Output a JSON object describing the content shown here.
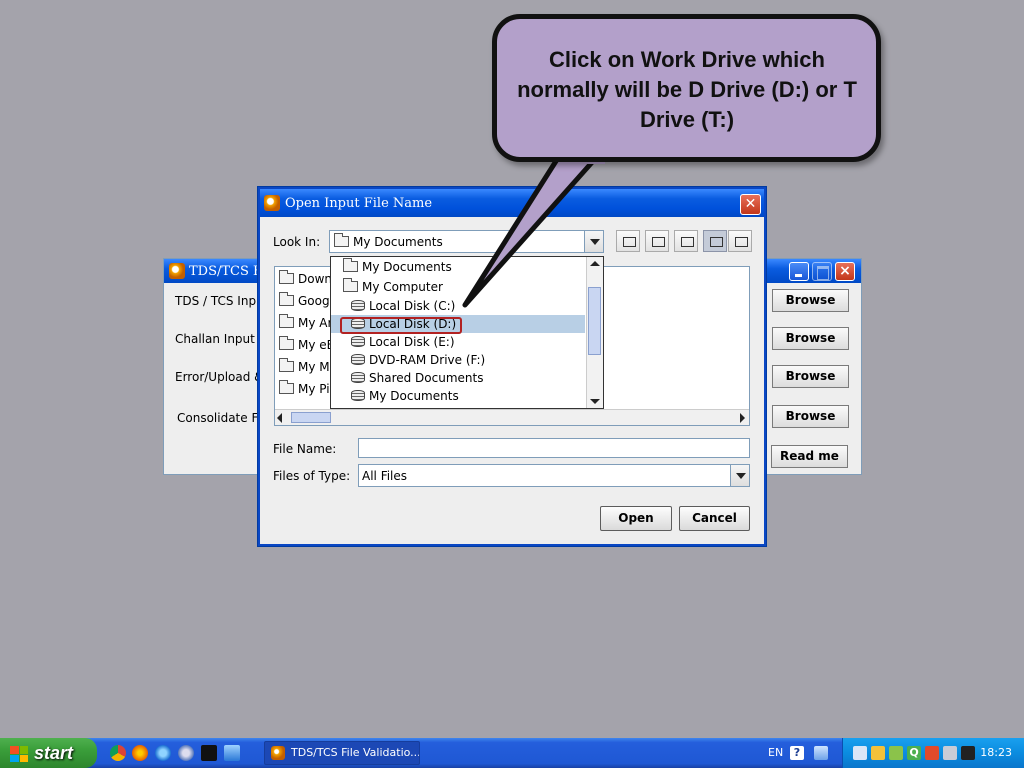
{
  "background_window": {
    "title": "TDS/TCS Fil",
    "labels": [
      "TDS / TCS Input",
      "Challan Input Fi",
      "Error/Upload &",
      "Consolidate Fil"
    ],
    "buttons": [
      "Browse",
      "Browse",
      "Browse",
      "Browse",
      "Read me"
    ]
  },
  "dialog": {
    "title": "Open Input File Name",
    "look_in_label": "Look In:",
    "look_in_value": "My Documents",
    "file_list": [
      "Downl",
      "Google",
      "My Art",
      "My eB",
      "My Mu",
      "My Pic"
    ],
    "dropdown_items": [
      {
        "label": "My Documents",
        "type": "folder"
      },
      {
        "label": "My Computer",
        "type": "folder"
      },
      {
        "label": "Local Disk (C:)",
        "type": "disk"
      },
      {
        "label": "Local Disk (D:)",
        "type": "disk",
        "selected": true
      },
      {
        "label": "Local Disk (E:)",
        "type": "disk"
      },
      {
        "label": "DVD-RAM Drive (F:)",
        "type": "disk"
      },
      {
        "label": "Shared Documents",
        "type": "disk"
      },
      {
        "label": "My Documents",
        "type": "disk"
      }
    ],
    "file_name_label": "File Name:",
    "file_name_value": "",
    "files_of_type_label": "Files of Type:",
    "files_of_type_value": "All Files",
    "open_button": "Open",
    "cancel_button": "Cancel"
  },
  "callout": {
    "text": "Click on Work Drive which normally will be D Drive (D:) or T Drive (T:)"
  },
  "taskbar": {
    "start_label": "start",
    "task_item": "TDS/TCS File Validatio...",
    "language": "EN",
    "clock": "18:23"
  },
  "colors": {
    "desktop": "#a4a3ab",
    "callout_fill": "#b3a0ca",
    "selection": "#b8cfe5",
    "highlight_border": "#b22222"
  }
}
